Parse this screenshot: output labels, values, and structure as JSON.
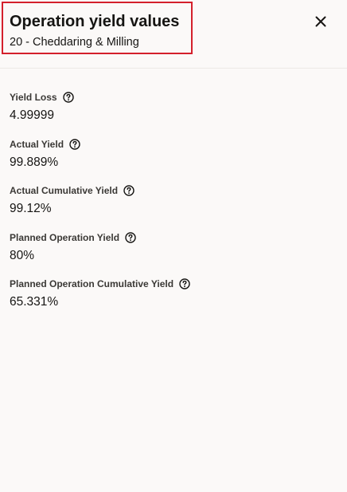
{
  "header": {
    "title": "Operation yield values",
    "subtitle": "20 - Cheddaring & Milling",
    "close_icon": "close-icon",
    "highlight_color": "#d4202c"
  },
  "fields": [
    {
      "label": "Yield Loss",
      "value": "4.99999",
      "icon": "help-icon"
    },
    {
      "label": "Actual Yield",
      "value": "99.889%",
      "icon": "help-icon"
    },
    {
      "label": "Actual Cumulative Yield",
      "value": "99.12%",
      "icon": "help-icon"
    },
    {
      "label": "Planned Operation Yield",
      "value": "80%",
      "icon": "help-icon"
    },
    {
      "label": "Planned Operation Cumulative Yield",
      "value": "65.331%",
      "icon": "help-icon"
    }
  ]
}
